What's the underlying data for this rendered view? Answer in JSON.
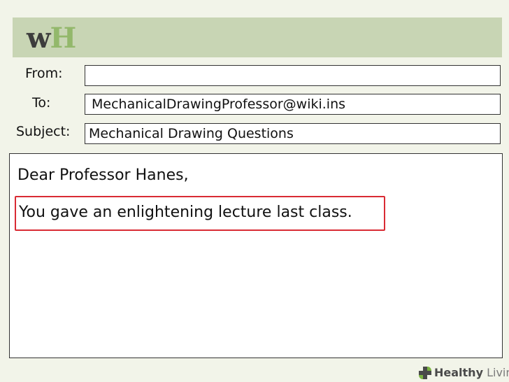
{
  "header": {
    "logo_w": "w",
    "logo_h": "H"
  },
  "form": {
    "from_label": "From:",
    "from_value": "",
    "to_label": "To:",
    "to_value": "MechanicalDrawingProfessor@wiki.ins",
    "subject_label": "Subject:",
    "subject_value": "Mechanical Drawing Questions"
  },
  "message": {
    "greeting": "Dear Professor Hanes,",
    "highlighted_line": "You gave an enlightening lecture last class."
  },
  "footer": {
    "brand_bold": "Healthy",
    "brand_light": " Living",
    "icon": "plus-leaf-icon"
  },
  "colors": {
    "header_bg": "#c8d5b4",
    "logo_dark": "#3d3d3d",
    "logo_green": "#93b86b",
    "highlight": "#d92b34",
    "background": "#f2f4e9"
  }
}
